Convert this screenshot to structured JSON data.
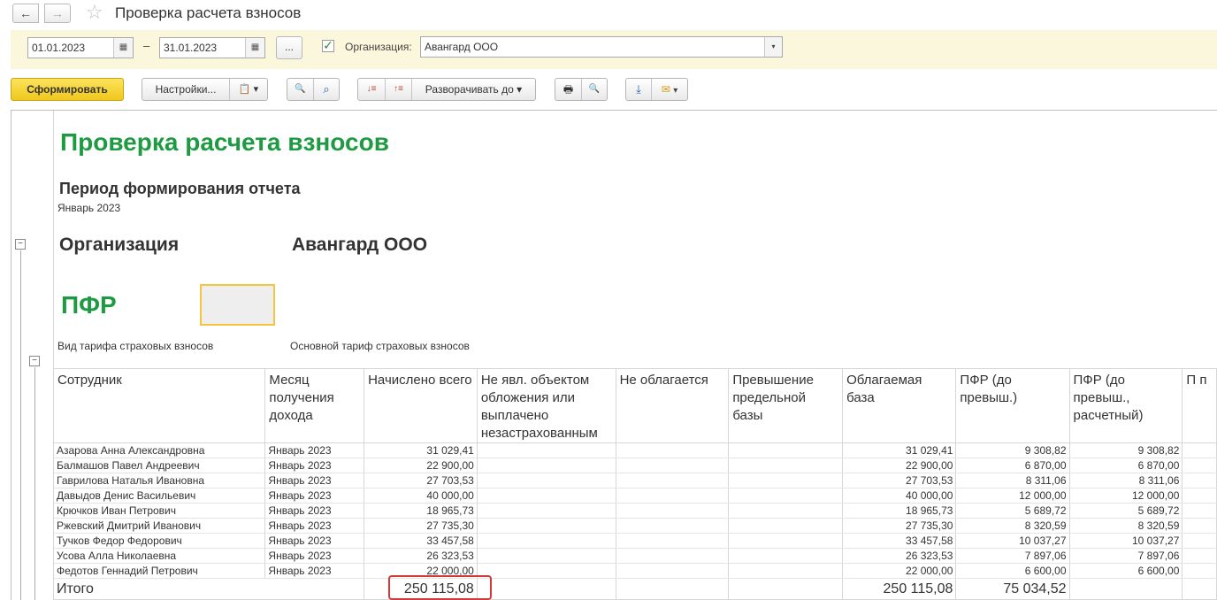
{
  "window": {
    "title": "Проверка расчета взносов",
    "back_label": "←",
    "forward_label": "→",
    "favorite_icon": "☆"
  },
  "filters": {
    "date_from": "01.01.2023",
    "date_to": "31.01.2023",
    "dash": "–",
    "more_label": "...",
    "org_checked_mark": "✓",
    "org_label": "Организация:",
    "org_value": "Авангард ООО",
    "calendar_icon": "▦",
    "dropdown_icon": "▾"
  },
  "toolbar": {
    "generate_label": "Сформировать",
    "settings_label": "Настройки...",
    "expand_label": "Разворачивать до",
    "dropdown_icon": "▾",
    "variant_icon": "📋",
    "search_icon": "🔍",
    "search_next_icon": "⌕",
    "sort_desc_icon": "↓≡",
    "sort_asc_icon": "↑≡",
    "print_icon": "🖶",
    "preview_icon": "🔍",
    "save_icon": "⤓",
    "mail_icon": "✉"
  },
  "colors": {
    "accent_green": "#1e9b42",
    "primary_yellow": "#f0c81d",
    "highlight_red": "#d23a3a",
    "filter_bg": "#fbf7dd"
  },
  "report": {
    "title": "Проверка расчета взносов",
    "period_heading": "Период формирования отчета",
    "period_value": "Январь 2023",
    "org_heading": "Организация",
    "org_value": "Авангард ООО",
    "fund": "ПФР",
    "tariff_label": "Вид тарифа страховых взносов",
    "tariff_value": "Основной тариф страховых взносов",
    "collapse_icon": "−",
    "columns": [
      "Сотрудник",
      "Месяц получения дохода",
      "Начислено всего",
      "Не явл. объектом обложения или выплачено незастрахованным",
      "Не облагается",
      "Превышение предельной базы",
      "Облагаемая база",
      "ПФР (до превыш.)",
      "ПФР (до превыш., расчетный)",
      "П п"
    ],
    "rows": [
      [
        "Азарова Анна Александровна",
        "Январь 2023",
        "31 029,41",
        "",
        "",
        "",
        "31 029,41",
        "9 308,82",
        "9 308,82"
      ],
      [
        "Балмашов Павел Андреевич",
        "Январь 2023",
        "22 900,00",
        "",
        "",
        "",
        "22 900,00",
        "6 870,00",
        "6 870,00"
      ],
      [
        "Гаврилова Наталья Ивановна",
        "Январь 2023",
        "27 703,53",
        "",
        "",
        "",
        "27 703,53",
        "8 311,06",
        "8 311,06"
      ],
      [
        "Давыдов Денис Васильевич",
        "Январь 2023",
        "40 000,00",
        "",
        "",
        "",
        "40 000,00",
        "12 000,00",
        "12 000,00"
      ],
      [
        "Крючков Иван Петрович",
        "Январь 2023",
        "18 965,73",
        "",
        "",
        "",
        "18 965,73",
        "5 689,72",
        "5 689,72"
      ],
      [
        "Ржевский Дмитрий Иванович",
        "Январь 2023",
        "27 735,30",
        "",
        "",
        "",
        "27 735,30",
        "8 320,59",
        "8 320,59"
      ],
      [
        "Тучков Федор Федорович",
        "Январь 2023",
        "33 457,58",
        "",
        "",
        "",
        "33 457,58",
        "10 037,27",
        "10 037,27"
      ],
      [
        "Усова Алла Николаевна",
        "Январь 2023",
        "26 323,53",
        "",
        "",
        "",
        "26 323,53",
        "7 897,06",
        "7 897,06"
      ],
      [
        "Федотов Геннадий Петрович",
        "Январь 2023",
        "22 000,00",
        "",
        "",
        "",
        "22 000,00",
        "6 600,00",
        "6 600,00"
      ]
    ],
    "total": {
      "label": "Итого",
      "accrued": "250 115,08",
      "taxable_base": "250 115,08",
      "pfr": "75 034,52"
    }
  }
}
